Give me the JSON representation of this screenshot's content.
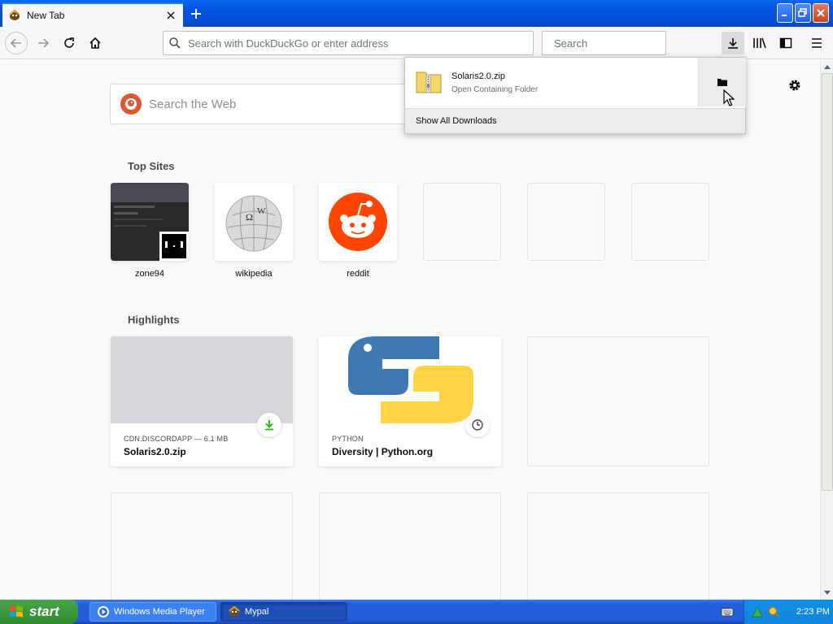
{
  "tab": {
    "title": "New Tab"
  },
  "toolbar": {
    "url_placeholder": "Search with DuckDuckGo or enter address",
    "search_placeholder": "Search"
  },
  "newtab": {
    "web_search_placeholder": "Search the Web",
    "top_sites_title": "Top Sites",
    "top_sites": [
      {
        "label": "zone94"
      },
      {
        "label": "wikipedia"
      },
      {
        "label": "reddit"
      }
    ],
    "highlights_title": "Highlights",
    "highlights": [
      {
        "context": "CDN.DISCORDAPP — 6.1 MB",
        "title": "Solaris2.0.zip",
        "badge": "download-icon"
      },
      {
        "context": "PYTHON",
        "title": "Diversity | Python.org",
        "badge": "clock-icon"
      }
    ]
  },
  "downloads_panel": {
    "filename": "Solaris2.0.zip",
    "status": "Open Containing Folder",
    "show_all": "Show All Downloads"
  },
  "taskbar": {
    "start_label": "start",
    "tasks": [
      {
        "label": "Windows Media Player"
      },
      {
        "label": "Mypal"
      }
    ],
    "clock": "2:23 PM"
  },
  "colors": {
    "accent": "#0a84ff",
    "download_green": "#12bc00",
    "xp_blue": "#245edb",
    "start_green": "#3c9a3c",
    "reddit": "#ff4500"
  }
}
